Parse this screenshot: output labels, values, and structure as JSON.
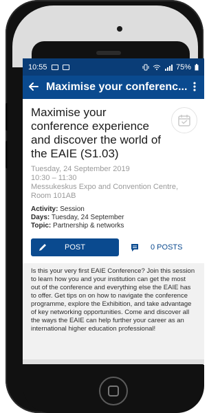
{
  "status": {
    "time": "10:55",
    "battery": "75%"
  },
  "appbar": {
    "title": "Maximise your conferenc...",
    "back_icon": "arrow-left-icon",
    "menu_icon": "more-vert-icon"
  },
  "event": {
    "title": "Maximise your conference experience and discover the world of the EAIE (S1.03)",
    "date": "Tuesday, 24 September 2019",
    "time": "10:30 – 11:30",
    "location": "Messukeskus Expo and Convention Centre, Room 101AB",
    "activity_label": "Activity:",
    "activity_value": "Session",
    "days_label": "Days:",
    "days_value": "Tuesday, 24 September",
    "topic_label": "Topic:",
    "topic_value": "Partnership & networks"
  },
  "actions": {
    "post_label": "POST",
    "posts_count_label": "0 POSTS"
  },
  "description": "Is this your very first EAIE Conference? Join this session to learn how you and your institution can get the most out of the conference and everything else the EAIE has to offer. Get tips on on how to navigate the conference programme, explore the Exhibition, and take advantage of key networking opportunities. Come and discover all the ways the EAIE can help further your career as an international higher education professional!",
  "colors": {
    "primary": "#0a4a8f",
    "statusbar": "#0a3d77",
    "background": "#e0e0e0"
  }
}
